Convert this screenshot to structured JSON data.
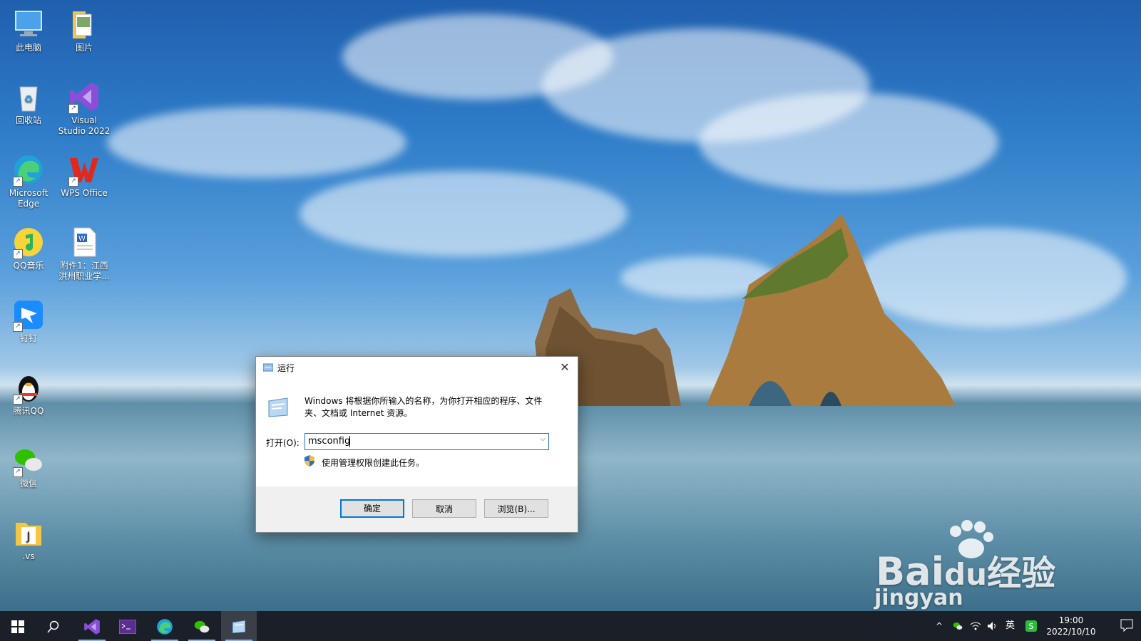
{
  "desktop": {
    "icons": [
      {
        "label": "此电脑"
      },
      {
        "label": "图片"
      },
      {
        "label": "回收站"
      },
      {
        "label": "Visual Studio 2022"
      },
      {
        "label": "Microsoft Edge"
      },
      {
        "label": "WPS Office"
      },
      {
        "label": "QQ音乐"
      },
      {
        "label": "附件1：江西洪州职业学..."
      },
      {
        "label": "钉钉"
      },
      {
        "label": "腾讯QQ"
      },
      {
        "label": "微信"
      },
      {
        "label": ".vs"
      }
    ]
  },
  "run_dialog": {
    "title": "运行",
    "close_glyph": "✕",
    "description": "Windows 将根据你所输入的名称，为你打开相应的程序、文件夹、文档或 Internet 资源。",
    "open_label": "打开(O):",
    "input_value": "msconfig",
    "admin_note": "使用管理权限创建此任务。",
    "ok_label": "确定",
    "cancel_label": "取消",
    "browse_label": "浏览(B)..."
  },
  "taskbar": {
    "ime_label": "英",
    "time": "19:00",
    "date": "2022/10/10",
    "tray_chevron": "^"
  },
  "watermark": {
    "brand": "Bai",
    "brand_tail": "经验",
    "url": "jingyan"
  },
  "colors": {
    "accent": "#0078d7",
    "taskbar": "#1b1f27"
  }
}
